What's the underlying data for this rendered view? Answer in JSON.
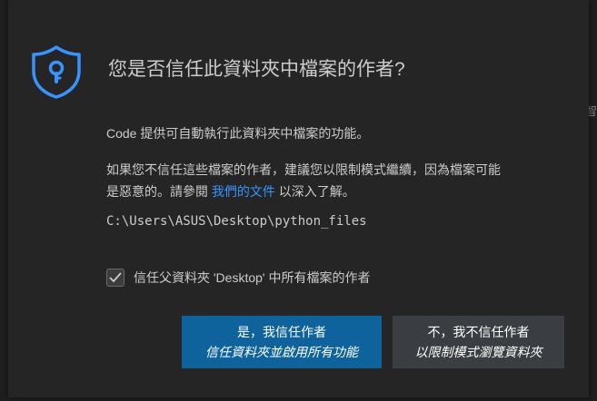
{
  "dialog": {
    "title": "您是否信任此資料夾中檔案的作者?",
    "paragraph1": "Code 提供可自動執行此資料夾中檔案的功能。",
    "paragraph2_line1": "如果您不信任這些檔案的作者，建議您以限制模式繼續，因為檔案可能",
    "paragraph2_line2_prefix": "是惡意的。請參閱 ",
    "paragraph2_link": "我們的文件",
    "paragraph2_line2_suffix": " 以深入了解。",
    "folder_path": "C:\\Users\\ASUS\\Desktop\\python_files",
    "checkbox_label": "信任父資料夾 'Desktop' 中所有檔案的作者",
    "checkbox_checked": true,
    "primary_button": {
      "line1": "是，我信任作者",
      "line2": "信任資料夾並啟用所有功能"
    },
    "secondary_button": {
      "line1": "不，我不信任作者",
      "line2": "以限制模式瀏覽資料夾"
    }
  },
  "background_fragments": {
    "char1": "智",
    "char2": "",
    "char3": ""
  },
  "colors": {
    "dialog_bg": "#252526",
    "text": "#cccccc",
    "link": "#3794ff",
    "primary_button": "#0e639c",
    "secondary_button": "#3a3d41",
    "shield": "#3794ff"
  },
  "icons": {
    "shield": "shield-lock-icon",
    "checkmark": "checkmark-icon"
  }
}
